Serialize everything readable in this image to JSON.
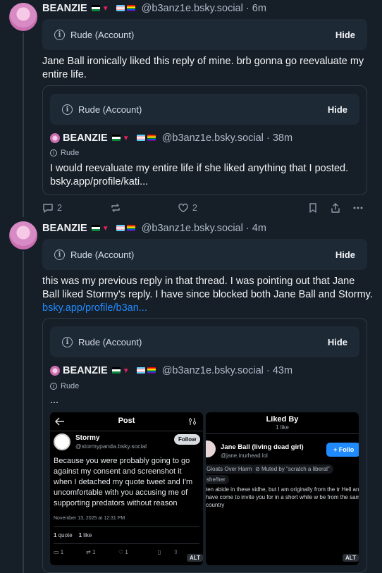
{
  "posts": [
    {
      "author_name": "BEANZIE",
      "author_emoji": "🎠 ▼",
      "handle": "@b3anz1e.bsky.social",
      "sep": "·",
      "time": "6m",
      "mod_label": "Rude (Account)",
      "hide_label": "Hide",
      "text": "Jane Ball ironically liked this reply of mine. brb gonna go reevaluate my entire life.",
      "quote": {
        "mod_label": "Rude (Account)",
        "hide_label": "Hide",
        "author_name": "BEANZIE",
        "handle": "@b3anz1e.bsky.social",
        "sep": "·",
        "time": "38m",
        "label": "Rude",
        "text": "I would reevaluate my entire life if she liked anything that I posted. bsky.app/profile/kati..."
      },
      "actions": {
        "replies": "2",
        "likes": "2"
      }
    },
    {
      "author_name": "BEANZIE",
      "handle": "@b3anz1e.bsky.social",
      "sep": "·",
      "time": "4m",
      "mod_label": "Rude (Account)",
      "hide_label": "Hide",
      "text": "this was my previous reply in that thread. I was pointing out that Jane Ball liked Stormy's reply. I have since blocked both Jane Ball and Stormy.",
      "link": "bsky.app/profile/b3an...",
      "quote": {
        "mod_label": "Rude (Account)",
        "hide_label": "Hide",
        "author_name": "BEANZIE",
        "handle": "@b3anz1e.bsky.social",
        "sep": "·",
        "time": "43m",
        "label": "Rude",
        "text": "..."
      }
    }
  ],
  "screenshot_left": {
    "title": "Post",
    "author": "Stormy",
    "handle": "@stormypanda.bsky.social",
    "follow": "Follow",
    "text": "Because you were probably going to go against my consent and screenshot it when I detached my quote tweet and I'm uncomfortable with you accusing me of supporting predators without reason",
    "date": "November 13, 2025 at 12:31 PM",
    "quote_count": "1",
    "quote_label": "quote",
    "like_count": "1",
    "like_label": "like",
    "replies": "1",
    "reposts": "1",
    "likes": "1",
    "alt": "ALT"
  },
  "screenshot_right": {
    "title": "Liked By",
    "subtitle": "1 like",
    "name": "Jane Ball (living dead girl)",
    "handle": "@jane.inurhead.lol",
    "follow": "+ Follo",
    "tag1": "Gloats Over Harm",
    "tag2": "Muted by \"scratch a liberal\"",
    "tag3": "she/her",
    "text": "ten abide in these sidhe, but I am originally from the tr Hell and I have come to invite you for in a short while w be from the same country",
    "alt": "ALT"
  },
  "colors": {
    "background": "#161e27",
    "accent": "#208bfe",
    "card": "#1e2936"
  }
}
